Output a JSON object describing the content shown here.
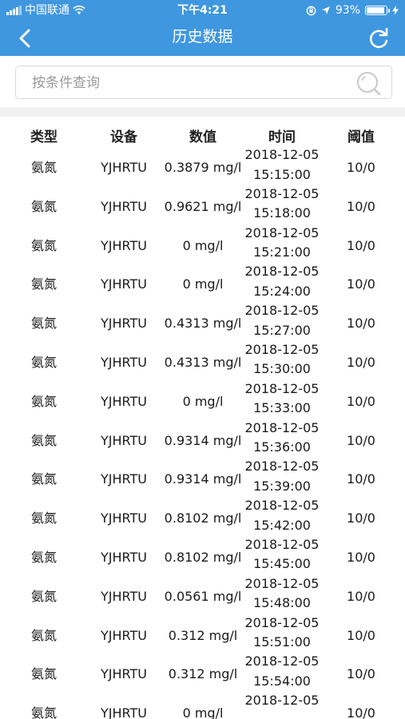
{
  "status_bar": {
    "carrier": "中国联通",
    "time": "下午4:21",
    "battery_text": "93%",
    "battery_level": 0.93
  },
  "nav": {
    "title": "历史数据"
  },
  "search": {
    "placeholder": "按条件查询",
    "value": ""
  },
  "table": {
    "headers": [
      "类型",
      "设备",
      "数值",
      "时间",
      "阈值"
    ],
    "rows": [
      {
        "type": "氨氮",
        "device": "YJHRTU",
        "value": "0.3879 mg/l",
        "date": "2018-12-05",
        "clock": "15:15:00",
        "threshold": "10/0"
      },
      {
        "type": "氨氮",
        "device": "YJHRTU",
        "value": "0.9621 mg/l",
        "date": "2018-12-05",
        "clock": "15:18:00",
        "threshold": "10/0"
      },
      {
        "type": "氨氮",
        "device": "YJHRTU",
        "value": "0 mg/l",
        "date": "2018-12-05",
        "clock": "15:21:00",
        "threshold": "10/0"
      },
      {
        "type": "氨氮",
        "device": "YJHRTU",
        "value": "0 mg/l",
        "date": "2018-12-05",
        "clock": "15:24:00",
        "threshold": "10/0"
      },
      {
        "type": "氨氮",
        "device": "YJHRTU",
        "value": "0.4313 mg/l",
        "date": "2018-12-05",
        "clock": "15:27:00",
        "threshold": "10/0"
      },
      {
        "type": "氨氮",
        "device": "YJHRTU",
        "value": "0.4313 mg/l",
        "date": "2018-12-05",
        "clock": "15:30:00",
        "threshold": "10/0"
      },
      {
        "type": "氨氮",
        "device": "YJHRTU",
        "value": "0 mg/l",
        "date": "2018-12-05",
        "clock": "15:33:00",
        "threshold": "10/0"
      },
      {
        "type": "氨氮",
        "device": "YJHRTU",
        "value": "0.9314 mg/l",
        "date": "2018-12-05",
        "clock": "15:36:00",
        "threshold": "10/0"
      },
      {
        "type": "氨氮",
        "device": "YJHRTU",
        "value": "0.9314 mg/l",
        "date": "2018-12-05",
        "clock": "15:39:00",
        "threshold": "10/0"
      },
      {
        "type": "氨氮",
        "device": "YJHRTU",
        "value": "0.8102 mg/l",
        "date": "2018-12-05",
        "clock": "15:42:00",
        "threshold": "10/0"
      },
      {
        "type": "氨氮",
        "device": "YJHRTU",
        "value": "0.8102 mg/l",
        "date": "2018-12-05",
        "clock": "15:45:00",
        "threshold": "10/0"
      },
      {
        "type": "氨氮",
        "device": "YJHRTU",
        "value": "0.0561 mg/l",
        "date": "2018-12-05",
        "clock": "15:48:00",
        "threshold": "10/0"
      },
      {
        "type": "氨氮",
        "device": "YJHRTU",
        "value": "0.312 mg/l",
        "date": "2018-12-05",
        "clock": "15:51:00",
        "threshold": "10/0"
      },
      {
        "type": "氨氮",
        "device": "YJHRTU",
        "value": "0.312 mg/l",
        "date": "2018-12-05",
        "clock": "15:54:00",
        "threshold": "10/0"
      },
      {
        "type": "氨氮",
        "device": "YJHRTU",
        "value": "0 mg/l",
        "date": "2018-12-05",
        "clock": "",
        "threshold": "10/0"
      }
    ]
  },
  "colors": {
    "header_blue": "#3f97e0",
    "background": "#ffffff",
    "divider": "#f2f2f2"
  },
  "icons": {
    "back": "chevron-left-icon",
    "refresh": "refresh-icon",
    "search": "search-icon",
    "wifi": "wifi-icon",
    "location": "location-arrow-icon",
    "lock": "orientation-lock-icon",
    "battery": "battery-icon",
    "charging": "charging-bolt-icon"
  }
}
